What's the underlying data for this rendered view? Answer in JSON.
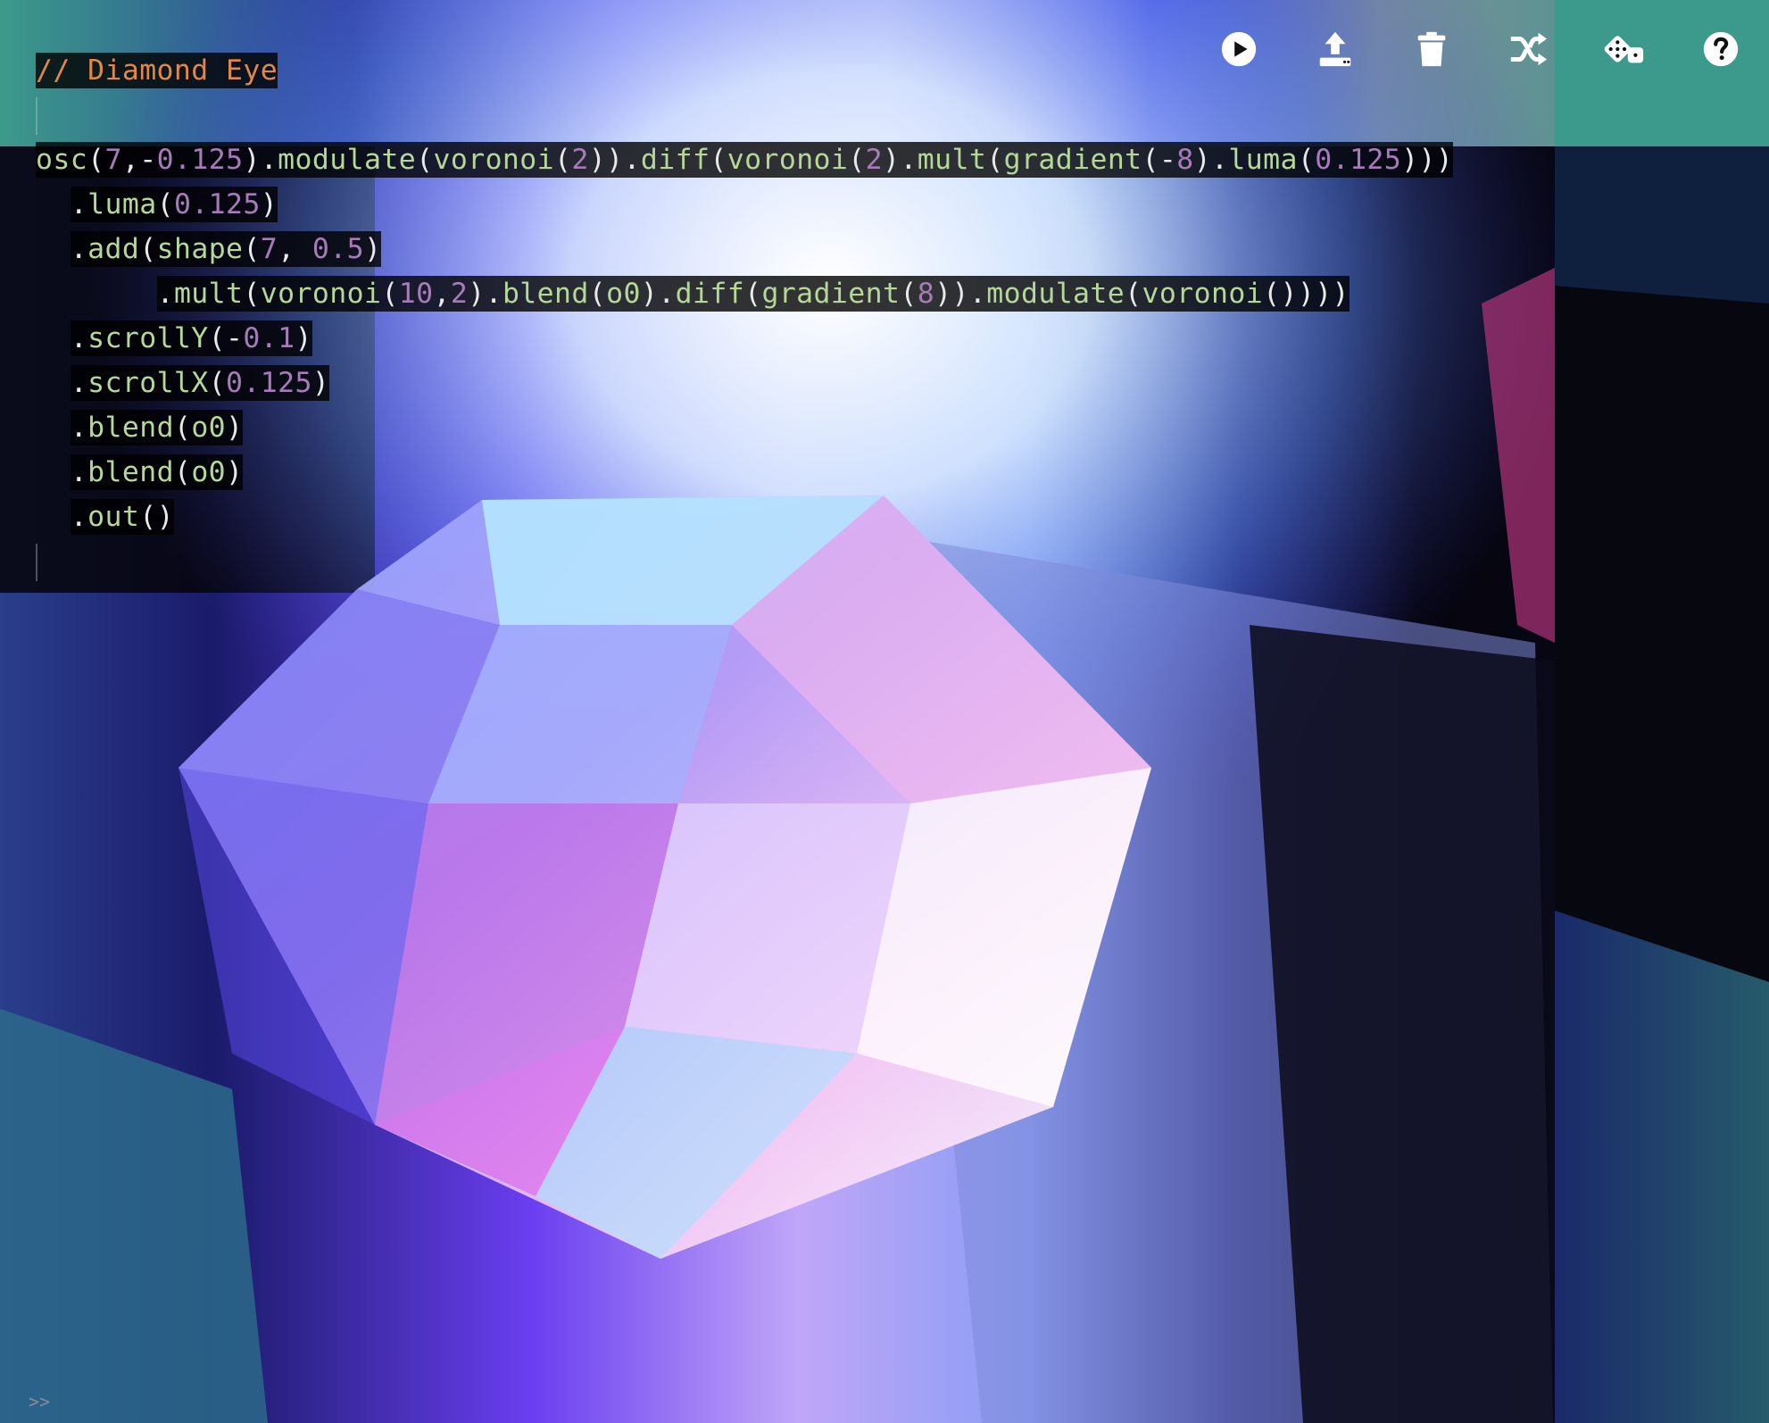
{
  "toolbar": {
    "buttons": [
      {
        "name": "run",
        "icon": "play-circle-icon"
      },
      {
        "name": "upload",
        "icon": "upload-icon"
      },
      {
        "name": "clear",
        "icon": "trash-icon"
      },
      {
        "name": "shuffle",
        "icon": "shuffle-icon"
      },
      {
        "name": "randomize",
        "icon": "dice-icon"
      },
      {
        "name": "help",
        "icon": "help-circle-icon"
      }
    ],
    "icon_color": "#ffffff"
  },
  "editor": {
    "title_comment": "// Diamond Eye",
    "lines": [
      "osc(7,-0.125).modulate(voronoi(2)).diff(voronoi(2).mult(gradient(-8).luma(0.125)))",
      "  .luma(0.125)",
      "  .add(shape(7, 0.5)",
      "       .mult(voronoi(10,2).blend(o0).diff(gradient(8)).modulate(voronoi())))",
      "  .scrollY(-0.1)",
      "  .scrollX(0.125)",
      "  .blend(o0)",
      "  .blend(o0)",
      "  .out()"
    ],
    "colors": {
      "comment": "#e0874a",
      "function": "#b6d79a",
      "number": "#a77bb8",
      "punctuation": "#e9e9e9"
    }
  },
  "console": {
    "prompt": ">>"
  }
}
